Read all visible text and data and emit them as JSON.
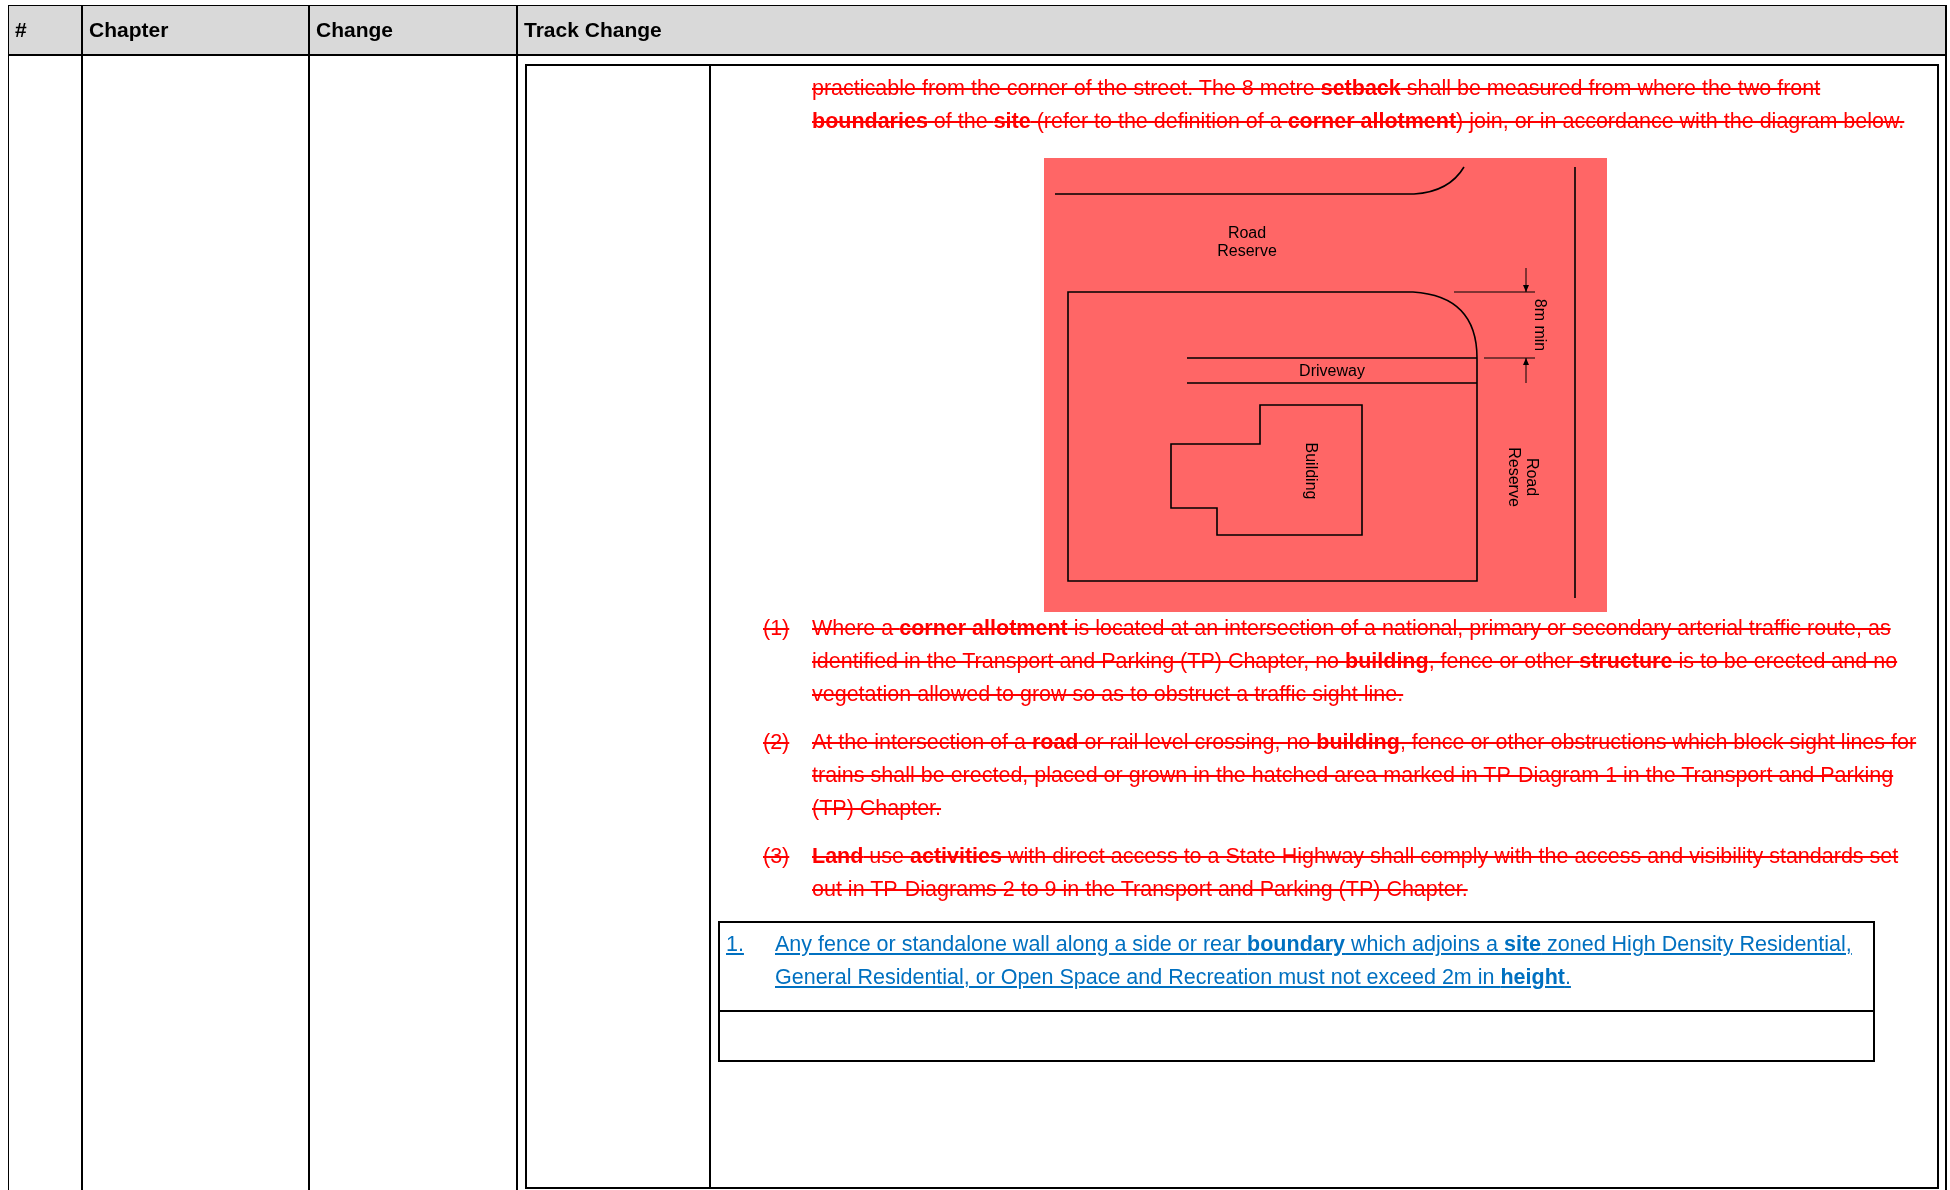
{
  "table": {
    "columns": [
      "#",
      "Chapter",
      "Change",
      "Track Change"
    ],
    "track_change": {
      "blocks": [
        {
          "kind": "deleted_paragraph",
          "text": "practicable from the corner of the street. The 8 metre **setback** shall be measured from where the two front **boundaries** of the **site** (refer to the definition of a **corner allotment**) join, or in accordance with the diagram below."
        },
        {
          "kind": "diagram",
          "labels": {
            "top_road": "Road Reserve",
            "driveway": "Driveway",
            "building": "Building",
            "setback": "8m min",
            "side_road": "Road Reserve"
          }
        },
        {
          "kind": "deleted_item",
          "number": "(1)",
          "text": "Where a **corner allotment** is located at an intersection of a national, primary or secondary arterial traffic route, as identified in the Transport and Parking (TP) Chapter, no **building**, fence or other **structure** is to be erected and no vegetation allowed to grow so as to obstruct a traffic sight line."
        },
        {
          "kind": "deleted_item",
          "number": "(2)",
          "text": "At the intersection of a **road** or rail level crossing, no **building**, fence or other obstructions which block sight lines for trains shall be erected, placed or grown in the hatched area marked in TP-Diagram 1 in the Transport and Parking (TP) Chapter."
        },
        {
          "kind": "deleted_item",
          "number": "(3)",
          "text": "**Land** use **activities** with direct access to a State Highway shall comply with the access and visibility standards set out in TP-Diagrams 2 to 9 in the Transport and Parking (TP) Chapter."
        },
        {
          "kind": "inserted_item",
          "number": "1.",
          "text": "Any fence or standalone wall along a side or rear **boundary** which adjoins a **site** zoned High Density Residential, General Residential, or Open Space and Recreation must not exceed 2m in **height**."
        }
      ]
    }
  }
}
